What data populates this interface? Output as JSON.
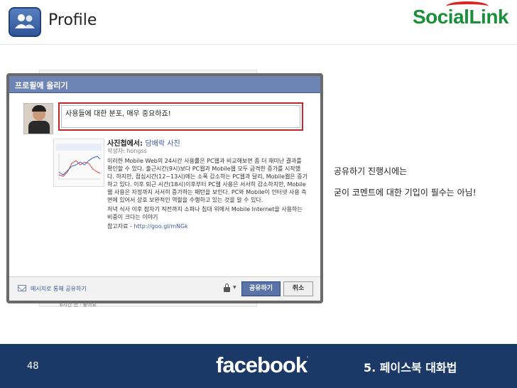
{
  "header": {
    "title": "Profile",
    "brand_part1": "Social",
    "brand_part2": "Link"
  },
  "dialog": {
    "title": "프로필에 올리기",
    "comment_text": "사용들에 대한 분포, 매우 중요하죠!",
    "post_title_prefix": "사진첩에서:",
    "post_title": "담배락 사진",
    "author": "작성자: hongss",
    "description": [
      "이러한 Mobile Web의 24시간 사용률은 PC웹과 비교해보면 좀 더 재미난 결과를 확인할 수 있다. 출근시간(9시)보다 PC웹과 Mobile웹 모두 급격한 증가를 시작했다. 하지만, 점심시간(12~13시)에는 소폭 감소하는 PC웹과 달리, Mobile웹은 증가하고 있다. 이후 퇴근 시간(18시)이후부터 PC웹 사용은 서서히 감소하지만, Mobile웹 사용은 자정까지 서서히 증가하는 패턴을 보인다. PC와 Mobile이 인터넷 사용 측면에 있어서 상호 보완적인 역할을 수행하고 있는 것을 알 수 있다.",
      "저녁 식사 이후 잠자기 직전까지 소파나 침대 위에서 Mobile Internet을 사용하는 비중이 크다는 이야기"
    ],
    "ref_label": "참고자료 - ",
    "ref_link": "http://goo.gl/mNGk",
    "message_link": "메시지로 통해 공유하기",
    "share_label": "공유하기",
    "cancel_label": "취소",
    "below_text": "6시간 전 · 좋아요"
  },
  "notes": {
    "line1": "공유하기 진행시에는",
    "line2": "굳이 코멘트에 대한 기입이 필수는 아님!"
  },
  "footer": {
    "page_number": "48",
    "logo": "facebook",
    "logo_mark": ".",
    "chapter": "5. 페이스북 대화법"
  },
  "colors": {
    "bottom_bar": "#1b3966",
    "dialog_header": "#6d84b4",
    "highlight_border": "#c0282b",
    "brand_green": "#1a8f3a"
  }
}
